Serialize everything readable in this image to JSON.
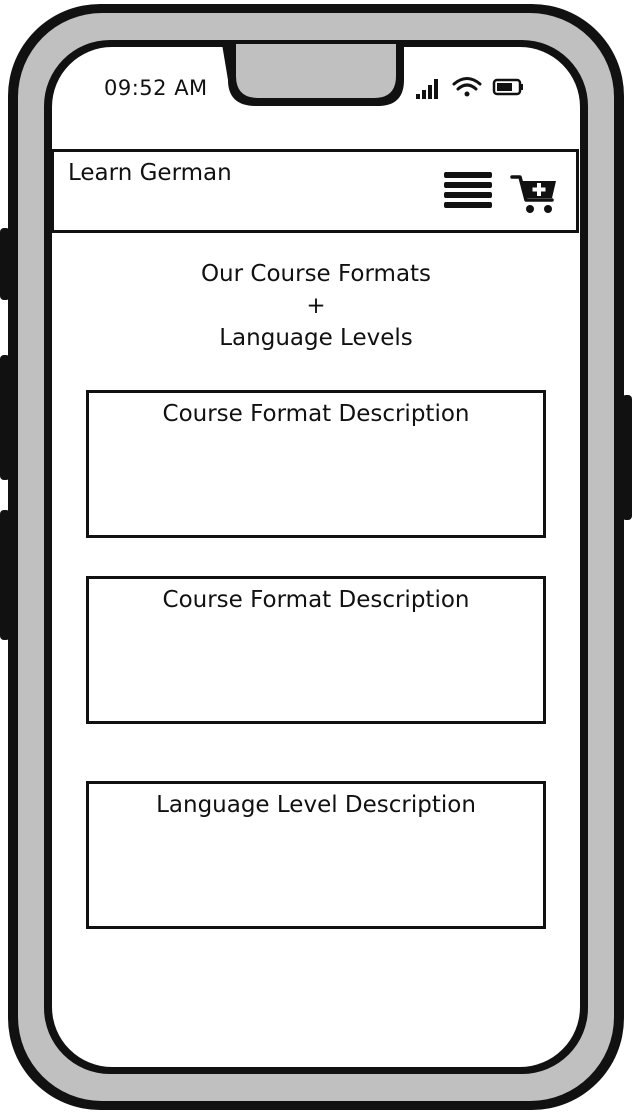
{
  "status_bar": {
    "time": "09:52 AM",
    "icons": [
      "signal-icon",
      "wifi-icon",
      "battery-icon"
    ]
  },
  "header": {
    "title": "Learn German",
    "menu_icon": "hamburger-menu-icon",
    "cart_icon": "add-to-cart-icon"
  },
  "page": {
    "heading_lines": [
      "Our Course Formats",
      "+",
      "Language Levels"
    ]
  },
  "cards": [
    {
      "title": "Course Format Description"
    },
    {
      "title": "Course Format Description"
    },
    {
      "title": "Language Level Description"
    }
  ],
  "colors": {
    "frame": "#c0c0c0",
    "outline": "#111111",
    "screen": "#ffffff"
  }
}
